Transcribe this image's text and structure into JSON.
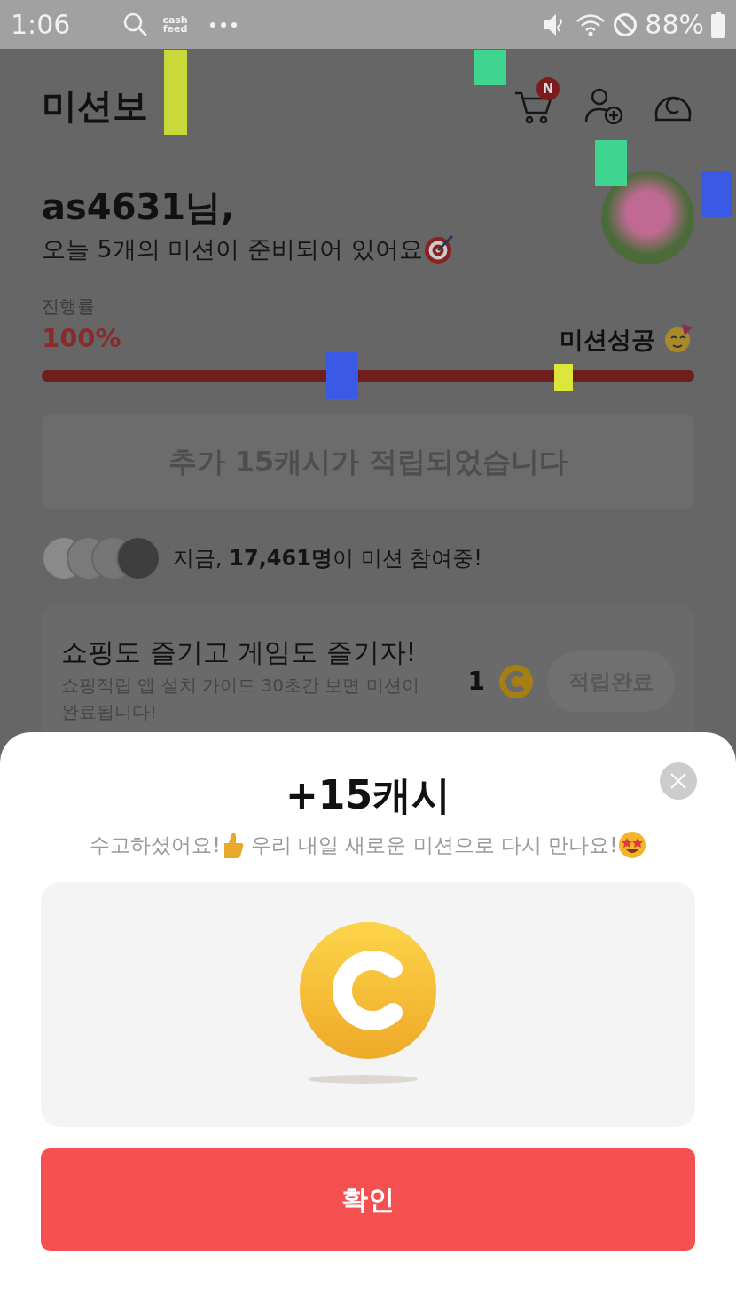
{
  "status_bar": {
    "time": "1:06",
    "app_logo_top": "cash",
    "app_logo_bottom": "feed",
    "battery": "88%"
  },
  "header": {
    "title": "미션보",
    "cart_badge": "N"
  },
  "greeting": {
    "name": "as4631님,",
    "message": "오늘 5개의 미션이 준비되어 있어요"
  },
  "progress": {
    "label": "진행률",
    "percent": "100%",
    "status": "미션성공",
    "level": 1
  },
  "bonus_notice": "추가 15캐시가 적립되었습니다",
  "participants": "지금, **17,461명**이 미션 참여중!",
  "missions": [
    {
      "title": "쇼핑도 즐기고 게임도 즐기자!",
      "description": "쇼핑적립 앱 설치 가이드 30초간 보면 미션이 완료됩니다!",
      "reward": "1",
      "button": "적립완료",
      "completed": true
    }
  ],
  "sheet": {
    "title": "+15캐시",
    "message_1": "수고하셨어요!",
    "message_2": "우리 내일 새로운 미션으로 다시 만나요!",
    "confirm": "확인"
  }
}
